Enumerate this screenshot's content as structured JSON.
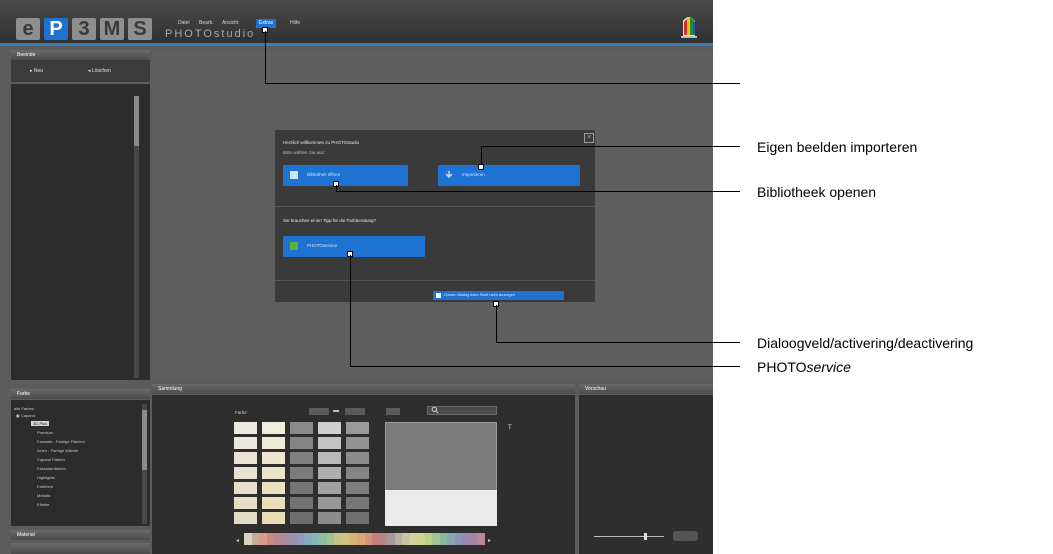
{
  "app": {
    "logo_letters": [
      "e",
      "P",
      "3",
      "M",
      "S"
    ],
    "product_name": "PHOTOstudio",
    "menu": [
      {
        "label": "Datei"
      },
      {
        "label": "Bearb."
      },
      {
        "label": "Ansicht"
      },
      {
        "label": "Extras"
      },
      {
        "label": "Hilfe"
      }
    ]
  },
  "left_panel": {
    "title": "Beeinde",
    "btn_new": "Neu",
    "btn_delete": "Löschen"
  },
  "farbe_panel": {
    "title": "Farbe",
    "tree": [
      {
        "label": "alle Farben"
      },
      {
        "label": "Caparol"
      },
      {
        "label": "3D-Plus"
      },
      {
        "label": "Premium"
      },
      {
        "label": "Fassade - Farbige Flächen"
      },
      {
        "label": "Innen - Farbige Wände"
      },
      {
        "label": "Caparol Farben"
      },
      {
        "label": "Fassadenfarben"
      },
      {
        "label": "Highlights"
      },
      {
        "label": "Farbtöne"
      },
      {
        "label": "Metallic"
      },
      {
        "label": "Effekte"
      }
    ],
    "next_title": "Material"
  },
  "sammlung": {
    "title": "Sammlung",
    "search_label": "Farbe",
    "preview_mark": "T"
  },
  "vorschau": {
    "title": "Vorschau"
  },
  "dialog": {
    "heading": "Herzlich willkommen zu PHOTOstudio",
    "subheading": "Bitte wählen Sie aus:",
    "btn_library": "Bibliothek öffnen",
    "btn_import": "Importieren",
    "question": "Sie brauchen einen Tipp für die Farbberatung?",
    "btn_service": "PHOTOservice",
    "checkbox_label": "Diesen Dialog beim Start nicht anzeigen"
  },
  "annotations": {
    "import": "Eigen beelden importeren",
    "library": "Bibliotheek openen",
    "dialog_toggle": "Dialoogveld/activering/deactivering",
    "service_prefix": "PHOTO",
    "service_suffix": "service"
  }
}
